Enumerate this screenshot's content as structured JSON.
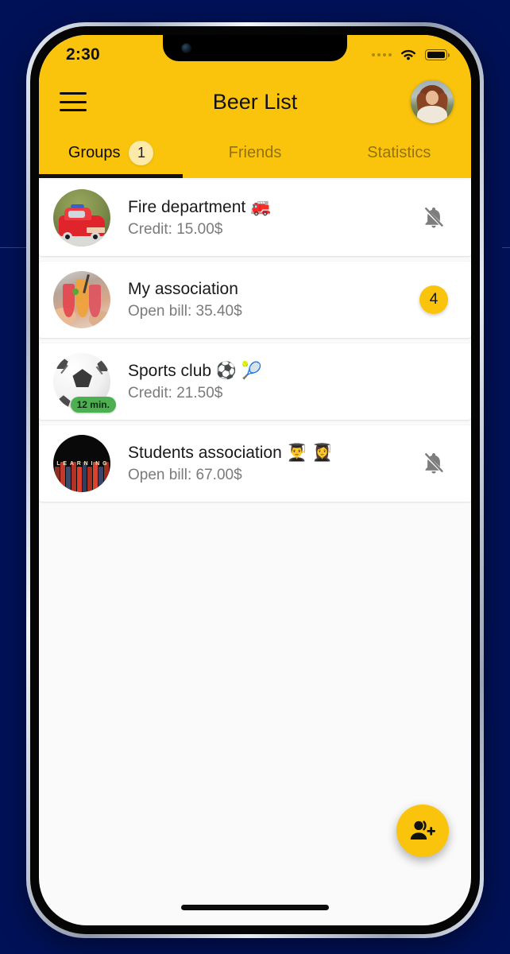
{
  "theme": {
    "brand_yellow": "#FBC40C",
    "backdrop_navy": "#001158",
    "page_bg": "#FAFAFA",
    "card_bg": "#FFFFFF",
    "badge_soft_yellow": "#FDE9A8",
    "time_badge_green": "#4CAF50",
    "muted_text": "#7B7B7B"
  },
  "status_bar": {
    "time": "2:30",
    "signal_icon": "signal-dots-icon",
    "wifi_icon": "wifi-icon",
    "battery_icon": "battery-full-icon"
  },
  "app_bar": {
    "menu_icon": "hamburger-menu-icon",
    "title": "Beer List",
    "avatar_icon": "user-avatar-photo"
  },
  "tabs": {
    "active_index": 0,
    "items": [
      {
        "label": "Groups",
        "badge": "1"
      },
      {
        "label": "Friends",
        "badge": ""
      },
      {
        "label": "Statistics",
        "badge": ""
      }
    ]
  },
  "groups": [
    {
      "title": "Fire department 🚒",
      "subtitle": "Credit: 15.00$",
      "thumb": "fire-truck-photo",
      "right_icon": "bell-muted-icon",
      "right_badge": "",
      "time_badge": ""
    },
    {
      "title": "My association",
      "subtitle": "Open bill: 35.40$",
      "thumb": "cocktails-toast-photo",
      "right_icon": "",
      "right_badge": "4",
      "time_badge": ""
    },
    {
      "title": "Sports club ⚽ 🎾",
      "subtitle": "Credit: 21.50$",
      "thumb": "soccer-ball-photo",
      "right_icon": "",
      "right_badge": "",
      "time_badge": "12 min."
    },
    {
      "title": "Students association 👨‍🎓 👩‍🎓",
      "subtitle": "Open bill: 67.00$",
      "thumb": "books-learning-photo",
      "right_icon": "bell-muted-icon",
      "right_badge": "",
      "time_badge": ""
    }
  ],
  "fab": {
    "icon": "add-person-icon"
  },
  "books_label_letters": [
    "L",
    "E",
    "A",
    "R",
    "N",
    "I",
    "N",
    "G"
  ]
}
